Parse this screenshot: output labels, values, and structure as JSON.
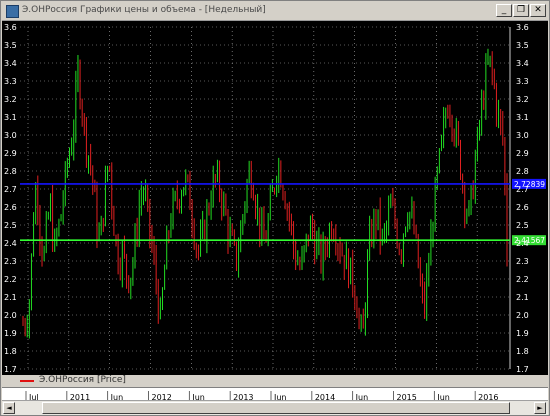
{
  "window": {
    "title": "Э.ОНРоссия Графики цены и объема - [Недельный]",
    "minimize_glyph": "_",
    "restore_glyph": "❐",
    "close_glyph": "✕"
  },
  "legend": {
    "label": "Э.ОНРоссия [Price]",
    "color": "#e01010"
  },
  "colors": {
    "up": "#22dd22",
    "down": "#e02020",
    "grid": "#b0b0b0",
    "blue_line": "#1414ff",
    "green_line": "#33ff33"
  },
  "chart_data": {
    "type": "bar",
    "description_type": "ohlc-weekly",
    "ylim": [
      1.7,
      3.6
    ],
    "y_ticks": [
      "3.6",
      "3.5",
      "3.4",
      "3.3",
      "3.2",
      "3.1",
      "3.0",
      "2.9",
      "2.8",
      "2.7",
      "2.6",
      "2.5",
      "2.4",
      "2.3",
      "2.2",
      "2.1",
      "2.0",
      "1.9",
      "1.8",
      "1.7"
    ],
    "x_axis_labels": [
      "Jul",
      "2011",
      "Jun",
      "2012",
      "Jun",
      "2013",
      "Jun",
      "2014",
      "Jun",
      "2015",
      "Jun",
      "2016"
    ],
    "horizontal_lines": [
      {
        "name": "blue",
        "value": 2.72839,
        "label": "2,72839"
      },
      {
        "name": "green",
        "value": 2.41567,
        "label": "2,41567"
      }
    ],
    "price_path": [
      1.95,
      1.98,
      2.1,
      2.55,
      2.75,
      2.45,
      2.3,
      2.5,
      2.6,
      2.35,
      2.45,
      2.55,
      2.7,
      2.85,
      2.95,
      3.1,
      3.35,
      3.2,
      3.0,
      2.9,
      2.8,
      2.6,
      2.4,
      2.5,
      2.7,
      2.9,
      2.6,
      2.4,
      2.3,
      2.35,
      2.25,
      2.2,
      2.3,
      2.45,
      2.65,
      2.7,
      2.6,
      2.45,
      2.3,
      2.15,
      1.95,
      2.2,
      2.4,
      2.55,
      2.6,
      2.65,
      2.7,
      2.75,
      2.7,
      2.6,
      2.45,
      2.35,
      2.4,
      2.5,
      2.6,
      2.7,
      2.75,
      2.72,
      2.65,
      2.55,
      2.45,
      2.38,
      2.3,
      2.4,
      2.55,
      2.7,
      2.8,
      2.75,
      2.6,
      2.5,
      2.4,
      2.45,
      2.6,
      2.7,
      2.85,
      2.8,
      2.7,
      2.6,
      2.5,
      2.35,
      2.3,
      2.25,
      2.35,
      2.45,
      2.5,
      2.4,
      2.35,
      2.3,
      2.38,
      2.45,
      2.52,
      2.48,
      2.4,
      2.35,
      2.3,
      2.25,
      2.2,
      2.1,
      1.95,
      1.85,
      2.2,
      2.4,
      2.5,
      2.55,
      2.45,
      2.4,
      2.5,
      2.6,
      2.55,
      2.45,
      2.35,
      2.5,
      2.6,
      2.55,
      2.45,
      2.3,
      2.1,
      2.05,
      2.25,
      2.45,
      2.65,
      2.8,
      2.95,
      3.1,
      3.2,
      3.1,
      3.0,
      2.9,
      2.75,
      2.6,
      2.55,
      2.7,
      2.9,
      3.05,
      3.2,
      3.35,
      3.4,
      3.3,
      3.15,
      3.05,
      2.95,
      2.35
    ]
  },
  "footer": {
    "scroll_left_glyph": "◄",
    "scroll_right_glyph": "►"
  }
}
